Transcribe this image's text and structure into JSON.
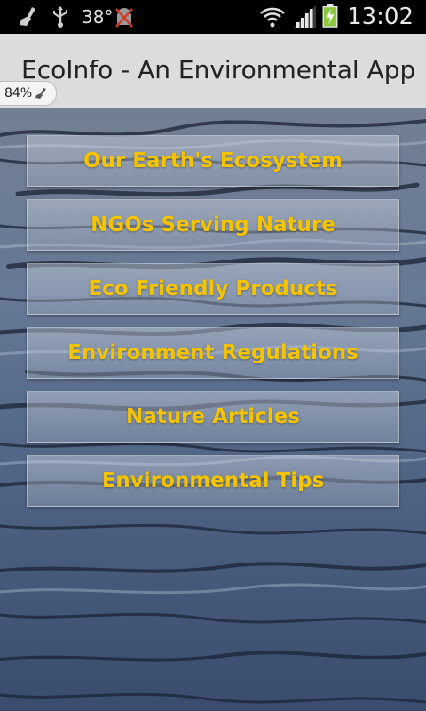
{
  "status_bar": {
    "temperature": "38°",
    "time": "13:02",
    "icons": [
      "broom-icon",
      "usb-icon",
      "android-debug-icon",
      "wifi-icon",
      "signal-icon",
      "battery-charging-icon"
    ]
  },
  "title_bar": {
    "title": "EcoInfo - An Environmental App"
  },
  "battery_chip": {
    "percent": "84%"
  },
  "menu": {
    "items": [
      {
        "label": "Our Earth's Ecosystem"
      },
      {
        "label": "NGOs Serving Nature"
      },
      {
        "label": "Eco Friendly Products"
      },
      {
        "label": "Environment Regulations"
      },
      {
        "label": "Nature Articles"
      },
      {
        "label": "Environmental Tips"
      }
    ]
  },
  "colors": {
    "button_text": "#f5c400",
    "title_bar_bg": "#dcdcdc",
    "status_bar_bg": "#000000"
  }
}
